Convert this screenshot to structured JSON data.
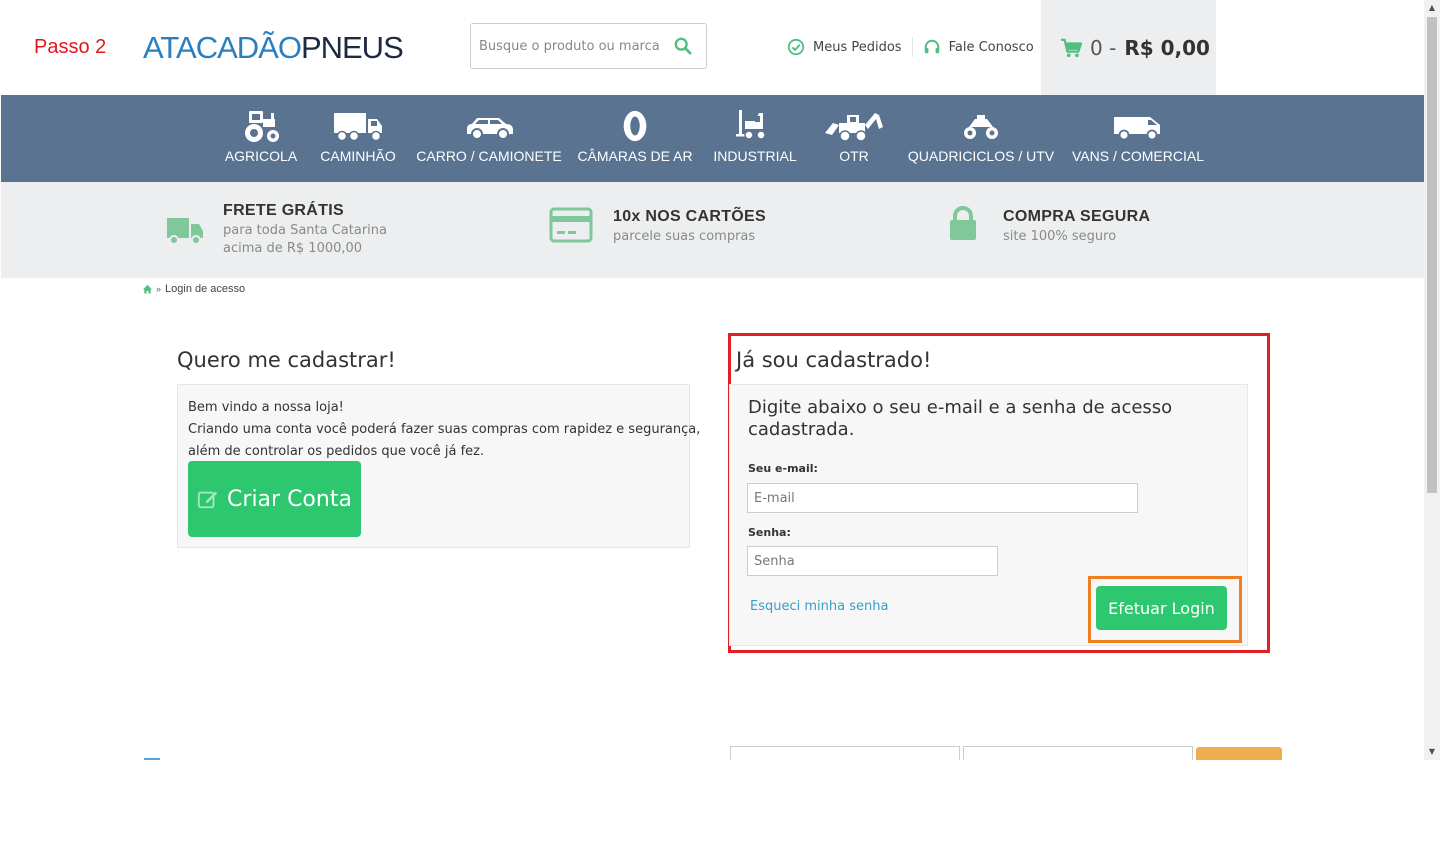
{
  "annotation": {
    "step": "Passo 2"
  },
  "header": {
    "logo": {
      "part1": "ATACADÃO",
      "part2": "PNEUS"
    },
    "search_placeholder": "Busque o produto ou marca",
    "links": [
      {
        "label": "Meus Pedidos",
        "icon": "check-circle-icon"
      },
      {
        "label": "Fale Conosco",
        "icon": "headset-icon"
      }
    ],
    "cart": {
      "count": "0 -",
      "total": "R$ 0,00",
      "icon": "cart-icon"
    }
  },
  "categories": [
    {
      "label": "AGRICOLA",
      "icon": "tractor-icon"
    },
    {
      "label": "CAMINHÃO",
      "icon": "truck-icon"
    },
    {
      "label": "CARRO / CAMIONETE",
      "icon": "car-icon"
    },
    {
      "label": "CÂMARAS DE AR",
      "icon": "tire-tube-icon"
    },
    {
      "label": "INDUSTRIAL",
      "icon": "forklift-icon"
    },
    {
      "label": "OTR",
      "icon": "backhoe-icon"
    },
    {
      "label": "QUADRICICLOS / UTV",
      "icon": "atv-icon"
    },
    {
      "label": "VANS / COMERCIAL",
      "icon": "van-icon"
    }
  ],
  "benefits": [
    {
      "title": "FRETE GRÁTIS",
      "line1": "para toda Santa Catarina",
      "line2": "acima de R$ 1000,00",
      "icon": "delivery-truck-icon"
    },
    {
      "title": "10x NOS CARTÕES",
      "line1": "parcele suas compras",
      "icon": "credit-card-icon"
    },
    {
      "title": "COMPRA SEGURA",
      "line1": "site 100% seguro",
      "icon": "lock-icon"
    }
  ],
  "breadcrumb": {
    "separator": "»",
    "current": "Login de acesso"
  },
  "register": {
    "title": "Quero me cadastrar!",
    "line1": "Bem vindo a nossa loja!",
    "line2": "Criando uma conta você poderá fazer suas compras com rapidez e segurança,",
    "line3": "além de controlar os pedidos que você já fez.",
    "button": "Criar Conta"
  },
  "login": {
    "title": "Já sou cadastrado!",
    "intro": "Digite abaixo o seu e-mail e a senha de acesso cadastrada.",
    "email_label": "Seu e-mail:",
    "email_placeholder": "E-mail",
    "password_label": "Senha:",
    "password_placeholder": "Senha",
    "forgot": "Esqueci minha senha",
    "button": "Efetuar Login"
  },
  "colors": {
    "nav_bg": "#5a7391",
    "green": "#2dc770",
    "annotation_red": "#e11f27",
    "annotation_orange": "#f07f22",
    "link_blue": "#3a9dc4"
  }
}
